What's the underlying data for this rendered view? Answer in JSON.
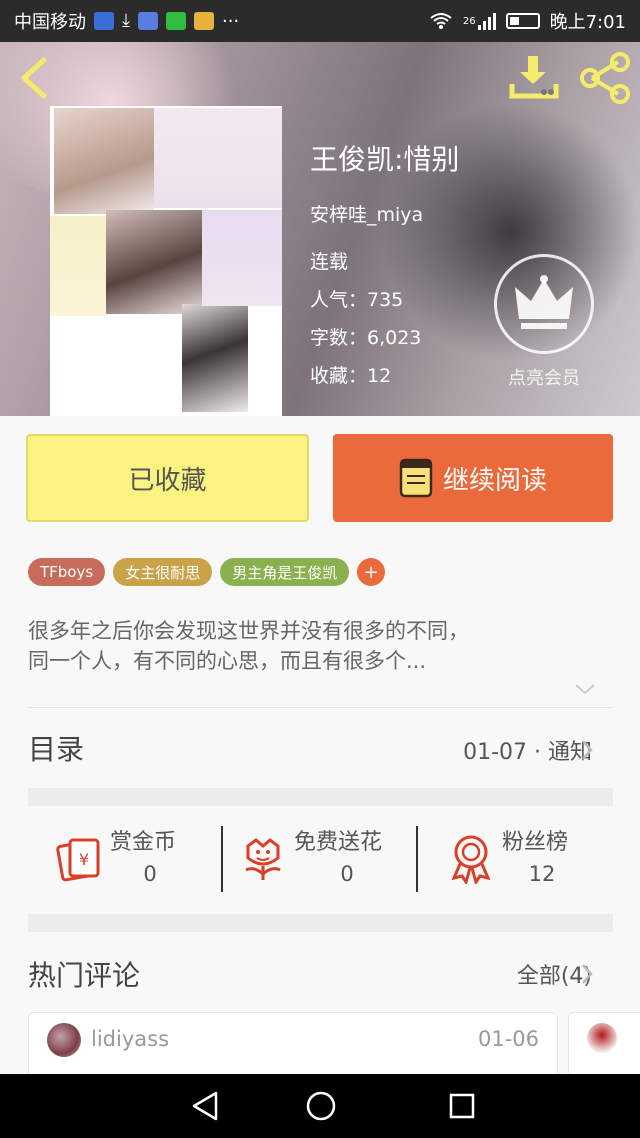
{
  "status_bar": {
    "carrier": "中国移动",
    "network": "26",
    "time": "晚上7:01"
  },
  "book": {
    "title": "王俊凯:惜别",
    "author": "安梓哇_miya",
    "status": "连载",
    "popularity": "人气：735",
    "word_count": "字数：6,023",
    "favorites": "收藏：12"
  },
  "vip": {
    "label": "点亮会员"
  },
  "actions": {
    "collect_label": "已收藏",
    "read_label": "继续阅读"
  },
  "tags": [
    {
      "label": "TFboys",
      "color": "#c76b5a"
    },
    {
      "label": "女主很耐思",
      "color": "#c9a24a"
    },
    {
      "label": "男主角是王俊凯",
      "color": "#8ab14e"
    }
  ],
  "tag_add": "+",
  "description": {
    "line1": "很多年之后你会发现这世界并没有很多的不同，",
    "line2": "同一个人，有不同的心思，而且有很多个..."
  },
  "toc": {
    "title": "目录",
    "latest": "01-07 · 通知"
  },
  "stats": {
    "reward": {
      "label": "赏金币",
      "value": "0"
    },
    "flowers": {
      "label": "免费送花",
      "value": "0"
    },
    "fans": {
      "label": "粉丝榜",
      "value": "12"
    }
  },
  "hot_comments": {
    "title": "热门评论",
    "all_label": "全部(4)"
  },
  "comments": [
    {
      "user": "lidiyass",
      "date": "01-06"
    }
  ],
  "colors": {
    "accent_orange": "#ea6a3c",
    "collect_yellow": "#fbf37f",
    "icon_red": "#d9402a",
    "top_icon_yellow": "#f6ec6b"
  },
  "icons": [
    "back-icon",
    "download-icon",
    "share-icon",
    "crown-icon",
    "book-icon",
    "chevron-down-icon",
    "chevron-right-icon",
    "red-envelope-icon",
    "flower-icon",
    "medal-icon",
    "nav-back-icon",
    "nav-home-icon",
    "nav-recent-icon"
  ]
}
